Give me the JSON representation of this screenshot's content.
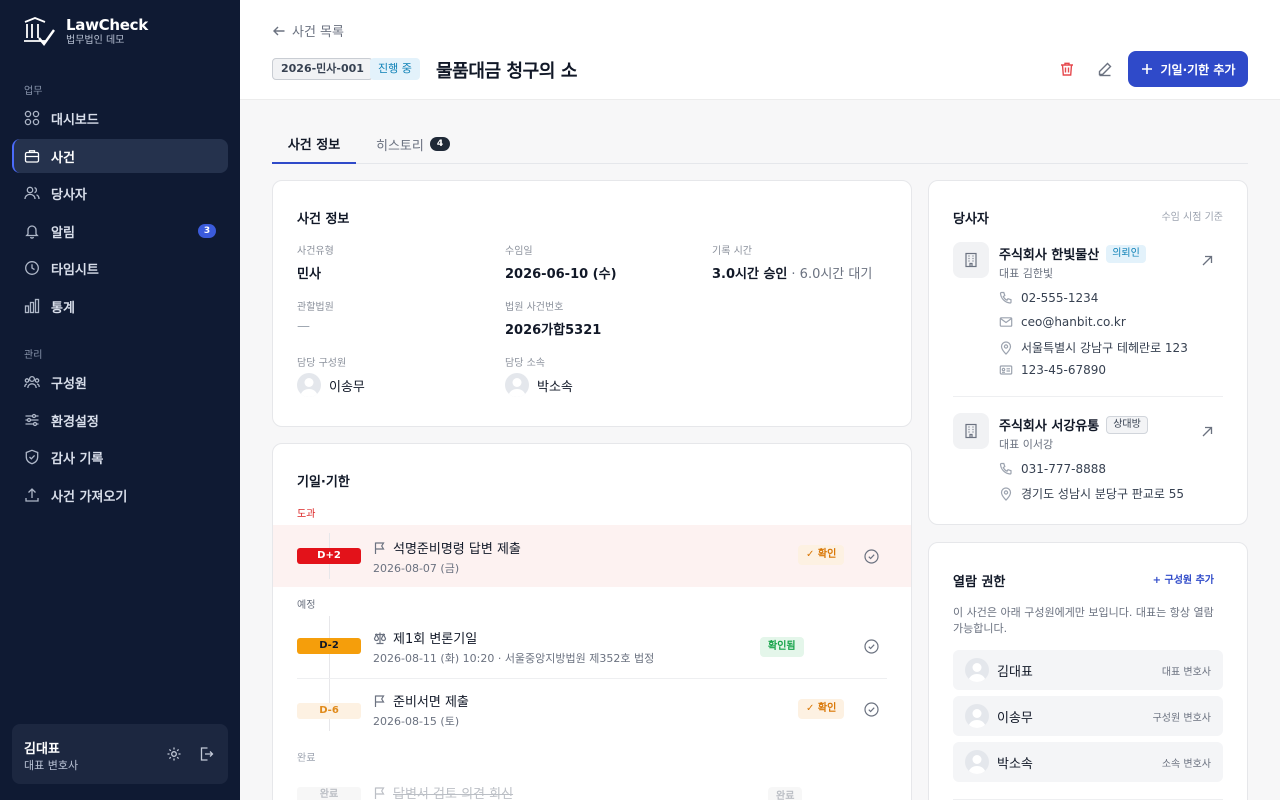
{
  "app": {
    "name": "LawCheck",
    "org": "법무법인 데모"
  },
  "sidebar": {
    "section_work": "업무",
    "section_admin": "관리",
    "items": [
      {
        "label": "대시보드",
        "icon": "grid-icon"
      },
      {
        "label": "사건",
        "icon": "briefcase-icon"
      },
      {
        "label": "당사자",
        "icon": "users-icon"
      },
      {
        "label": "알림",
        "icon": "bell-icon",
        "badge": "3"
      },
      {
        "label": "타임시트",
        "icon": "clock-icon"
      },
      {
        "label": "통계",
        "icon": "bar-chart-icon"
      },
      {
        "label": "구성원",
        "icon": "team-icon"
      },
      {
        "label": "환경설정",
        "icon": "sliders-icon"
      },
      {
        "label": "감사 기록",
        "icon": "shield-icon"
      },
      {
        "label": "사건 가져오기",
        "icon": "upload-icon"
      }
    ],
    "user": {
      "name": "김대표",
      "role": "대표 변호사"
    }
  },
  "header": {
    "back_label": "사건 목록",
    "case_number": "2026-민사-001",
    "status": "진행 중",
    "title": "물품대금 청구의 소",
    "add_button": "기일·기한 추가"
  },
  "tabs": [
    {
      "label": "사건 정보"
    },
    {
      "label": "히스토리",
      "badge": "4"
    }
  ],
  "case_info": {
    "title": "사건 정보",
    "fields": {
      "type_label": "사건유형",
      "type": "민사",
      "date_label": "수임일",
      "date": "2026-06-10 (수)",
      "time_label": "기록 시간",
      "time_approved": "3.0시간 승인",
      "time_pending": "· 6.0시간 대기",
      "court_label": "관할법원",
      "court": "—",
      "court_no_label": "법원 사건번호",
      "court_no": "2026가합5321",
      "member_label": "담당 구성원",
      "member": "이송무",
      "dept_label": "담당 소속",
      "dept": "박소속"
    }
  },
  "deadlines": {
    "title": "기일·기한",
    "groups": {
      "overdue": "도과",
      "scheduled": "예정",
      "done": "완료"
    },
    "items": [
      {
        "d": "D+2",
        "title": "석명준비명령 답변 제출",
        "sub": "2026-08-07 (금)",
        "chip": "확인"
      },
      {
        "d": "D-2",
        "title": "제1회 변론기일",
        "sub": "2026-08-11 (화) 10:20 · 서울중앙지방법원 제352호 법정",
        "chip": "확인됨"
      },
      {
        "d": "D-6",
        "title": "준비서면 제출",
        "sub": "2026-08-15 (토)",
        "chip": "확인"
      },
      {
        "d": "완료",
        "title": "답변서 검토 의견 회신",
        "chip": "완료"
      }
    ],
    "colors": {
      "overdue": "#e3121a",
      "soon": "#f59e0b",
      "later": "#fdf1e2"
    }
  },
  "parties": {
    "title": "당사자",
    "note": "수임 시점 기준",
    "list": [
      {
        "name": "주식회사 한빛물산",
        "tag": "의뢰인",
        "rep": "대표 김한빛",
        "phone": "02-555-1234",
        "email": "ceo@hanbit.co.kr",
        "address": "서울특별시 강남구 테헤란로 123",
        "biz_no": "123-45-67890"
      },
      {
        "name": "주식회사 서강유통",
        "tag": "상대방",
        "rep": "대표 이서강",
        "phone": "031-777-8888",
        "address": "경기도 성남시 분당구 판교로 55"
      }
    ]
  },
  "permissions": {
    "title": "열람 권한",
    "add_label": "+ 구성원 추가",
    "desc": "이 사건은 아래 구성원에게만 보입니다. 대표는 항상 열람 가능합니다.",
    "members": [
      {
        "name": "김대표",
        "role": "대표 변호사"
      },
      {
        "name": "이송무",
        "role": "구성원 변호사"
      },
      {
        "name": "박소속",
        "role": "소속 변호사"
      }
    ]
  }
}
